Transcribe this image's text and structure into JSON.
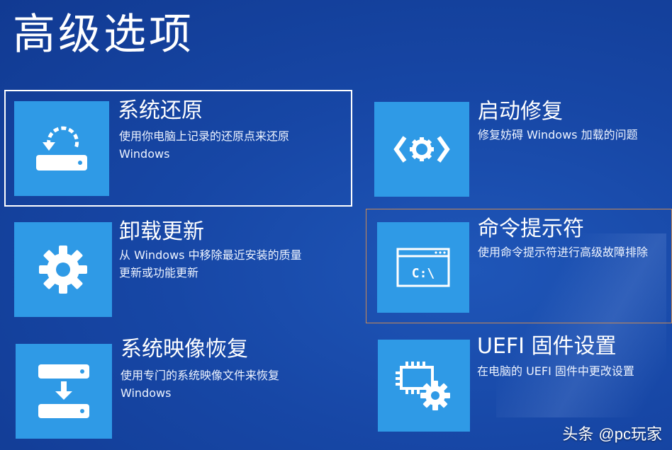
{
  "page": {
    "title": "高级选项"
  },
  "options": [
    {
      "id": "system_restore",
      "title": "系统还原",
      "description": "使用你电脑上记录的还原点来还原\nWindows",
      "icon": "restore-icon"
    },
    {
      "id": "startup_repair",
      "title": "启动修复",
      "description": "修复妨碍 Windows 加载的问题",
      "icon": "startup-repair-icon"
    },
    {
      "id": "uninstall_updates",
      "title": "卸载更新",
      "description": "从 Windows 中移除最近安装的质量\n更新或功能更新",
      "icon": "gear-icon"
    },
    {
      "id": "command_prompt",
      "title": "命令提示符",
      "description": "使用命令提示符进行高级故障排除",
      "icon": "command-prompt-icon",
      "icon_text": "C:\\"
    },
    {
      "id": "system_image_recovery",
      "title": "系统映像恢复",
      "description": "使用专门的系统映像文件来恢复\nWindows",
      "icon": "image-recovery-icon"
    },
    {
      "id": "uefi_settings",
      "title": "UEFI 固件设置",
      "description": "在电脑的 UEFI 固件中更改设置",
      "icon": "uefi-chip-gear-icon"
    }
  ],
  "watermark": {
    "prefix": "头条 ",
    "handle": "@pc玩家"
  },
  "colors": {
    "background": "#1747a6",
    "tile": "#2f9ae6",
    "focus_border": "#ffffff",
    "highlight_border": "#c98a55"
  }
}
